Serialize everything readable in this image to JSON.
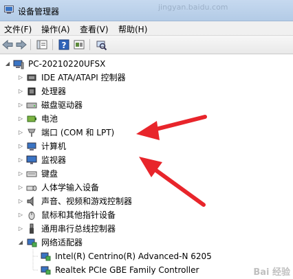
{
  "window": {
    "title": "设备管理器",
    "ghost_text": "jingyan.baidu.com"
  },
  "menu": [
    {
      "label": "文件(F)"
    },
    {
      "label": "操作(A)"
    },
    {
      "label": "查看(V)"
    },
    {
      "label": "帮助(H)"
    }
  ],
  "tree": {
    "root": "PC-20210220UFSX",
    "items": [
      {
        "label": "IDE ATA/ATAPI 控制器",
        "icon": "ide-controller-icon"
      },
      {
        "label": "处理器",
        "icon": "processor-icon"
      },
      {
        "label": "磁盘驱动器",
        "icon": "disk-drive-icon"
      },
      {
        "label": "电池",
        "icon": "battery-icon"
      },
      {
        "label": "端口 (COM 和 LPT)",
        "icon": "port-icon"
      },
      {
        "label": "计算机",
        "icon": "computer-icon"
      },
      {
        "label": "监视器",
        "icon": "monitor-icon"
      },
      {
        "label": "键盘",
        "icon": "keyboard-icon"
      },
      {
        "label": "人体学输入设备",
        "icon": "hid-icon"
      },
      {
        "label": "声音、视频和游戏控制器",
        "icon": "sound-icon"
      },
      {
        "label": "鼠标和其他指针设备",
        "icon": "mouse-icon"
      },
      {
        "label": "通用串行总线控制器",
        "icon": "usb-icon"
      },
      {
        "label": "网络适配器",
        "icon": "network-adapter-icon"
      }
    ],
    "children": [
      {
        "label": "Intel(R) Centrino(R) Advanced-N 6205"
      },
      {
        "label": "Realtek PCIe GBE Family Controller"
      }
    ]
  },
  "colors": {
    "annotation_arrow": "#e8252b"
  },
  "watermark": "Bai 经验"
}
